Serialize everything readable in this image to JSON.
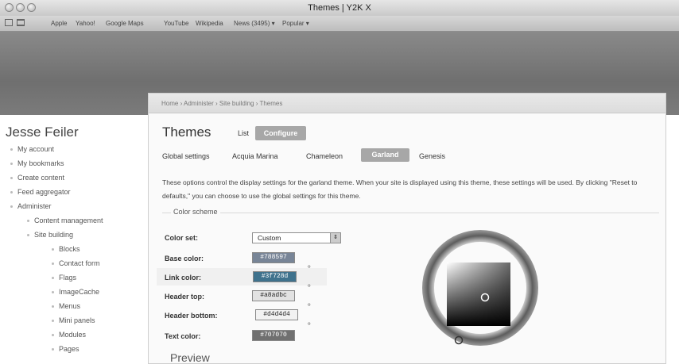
{
  "window": {
    "title": "Themes | Y2K X"
  },
  "bookmarks": [
    "Apple",
    "Yahoo!",
    "Google Maps",
    "YouTube",
    "Wikipedia",
    "News (3495) ▾",
    "Popular ▾"
  ],
  "breadcrumb": "Home › Administer › Site building › Themes",
  "sidebar": {
    "site_name": "Jesse Feiler",
    "items": [
      "My account",
      "My bookmarks",
      "Create content",
      "Feed aggregator",
      "Administer",
      "Content management",
      "Site building",
      "Blocks",
      "Contact form",
      "Flags",
      "ImageCache",
      "Menus",
      "Mini panels",
      "Modules",
      "Pages"
    ]
  },
  "main": {
    "title": "Themes",
    "tabs": {
      "list": "List",
      "configure": "Configure"
    },
    "subtabs": [
      "Global settings",
      "Acquia Marina",
      "Chameleon",
      "Garland",
      "Genesis"
    ],
    "description": "These options control the display settings for the garland theme. When your site is displayed using this theme, these settings will be used. By clicking \"Reset to defaults,\" you can choose to use the global settings for this theme.",
    "color_scheme": {
      "legend": "Color scheme",
      "color_set_label": "Color set:",
      "color_set_value": "Custom",
      "fields": [
        {
          "label": "Base color:",
          "value": "#788597",
          "bg": "#788597",
          "fg": "#ffffff"
        },
        {
          "label": "Link color:",
          "value": "#3f728d",
          "bg": "#3f728d",
          "fg": "#ffffff"
        },
        {
          "label": "Header top:",
          "value": "#a8adbc",
          "bg": "#e2e2e2",
          "fg": "#222222"
        },
        {
          "label": "Header bottom:",
          "value": "#d4d4d4",
          "bg": "#f2f2f2",
          "fg": "#222222"
        },
        {
          "label": "Text color:",
          "value": "#707070",
          "bg": "#707070",
          "fg": "#ffffff"
        }
      ]
    },
    "preview_label": "Preview"
  }
}
